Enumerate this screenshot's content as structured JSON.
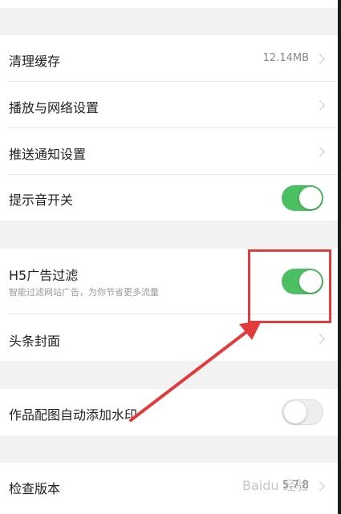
{
  "settings": {
    "clear_cache": {
      "label": "清理缓存",
      "value": "12.14MB"
    },
    "playback_network": {
      "label": "播放与网络设置"
    },
    "push_notifications": {
      "label": "推送通知设置"
    },
    "sound_toggle": {
      "label": "提示音开关",
      "state": "on"
    },
    "h5_ad_filter": {
      "label": "H5广告过滤",
      "sublabel": "智能过滤网站广告，为你节省更多流量",
      "state": "on"
    },
    "headline_cover": {
      "label": "头条封面"
    },
    "watermark_toggle": {
      "label": "作品配图自动添加水印",
      "state": "off"
    },
    "check_version": {
      "label": "检查版本",
      "value": "5.7.8"
    }
  },
  "colors": {
    "toggle_on": "#4cbf62",
    "annotation_red": "#e23b3b"
  },
  "watermark": {
    "text": "Baidu 经验"
  }
}
